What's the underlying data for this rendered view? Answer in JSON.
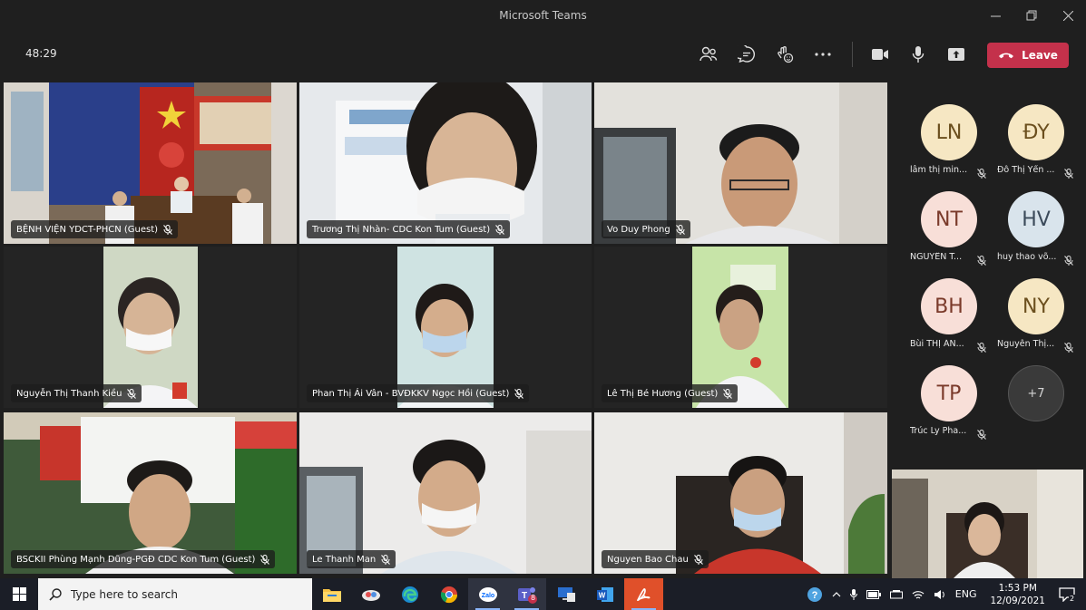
{
  "window": {
    "title": "Microsoft Teams"
  },
  "toolbar": {
    "timer": "48:29",
    "leave_label": "Leave"
  },
  "tiles": [
    {
      "name": "BỆNH VIỆN YDCT-PHCN (Guest)"
    },
    {
      "name": "Trương Thị Nhàn- CDC Kon Tum (Guest)"
    },
    {
      "name": "Vo Duy Phong"
    },
    {
      "name": "Nguyễn Thị Thanh Kiều"
    },
    {
      "name": "Phan Thị Ái Vân - BVĐKKV Ngọc Hồi (Guest)"
    },
    {
      "name": "Lê Thị Bé Hương (Guest)"
    },
    {
      "name": "BSCKII Phùng Mạnh Dũng-PGĐ CDC Kon Tum (Guest)"
    },
    {
      "name": "Le Thanh Man"
    },
    {
      "name": "Nguyen Bao Chau"
    }
  ],
  "roster": [
    {
      "initials": "LN",
      "name": "lâm thị min..."
    },
    {
      "initials": "ĐY",
      "name": "Đỗ Thị Yến ..."
    },
    {
      "initials": "NT",
      "name": "NGUYỄN T..."
    },
    {
      "initials": "HV",
      "name": "huy thao võ..."
    },
    {
      "initials": "BH",
      "name": "Bùi THỊ ÁN..."
    },
    {
      "initials": "NY",
      "name": "Nguyễn Thị..."
    },
    {
      "initials": "TP",
      "name": "Trúc Ly Pha..."
    },
    {
      "initials": "+7",
      "name": ""
    }
  ],
  "taskbar": {
    "search_placeholder": "Type here to search",
    "lang": "ENG",
    "time": "1:53 PM",
    "date": "12/09/2021",
    "notif_count": "2",
    "teams_badge": "8"
  },
  "colors": {
    "leave": "#c4314b",
    "background": "#1f1f1f",
    "taskbar": "#1b1e27"
  }
}
